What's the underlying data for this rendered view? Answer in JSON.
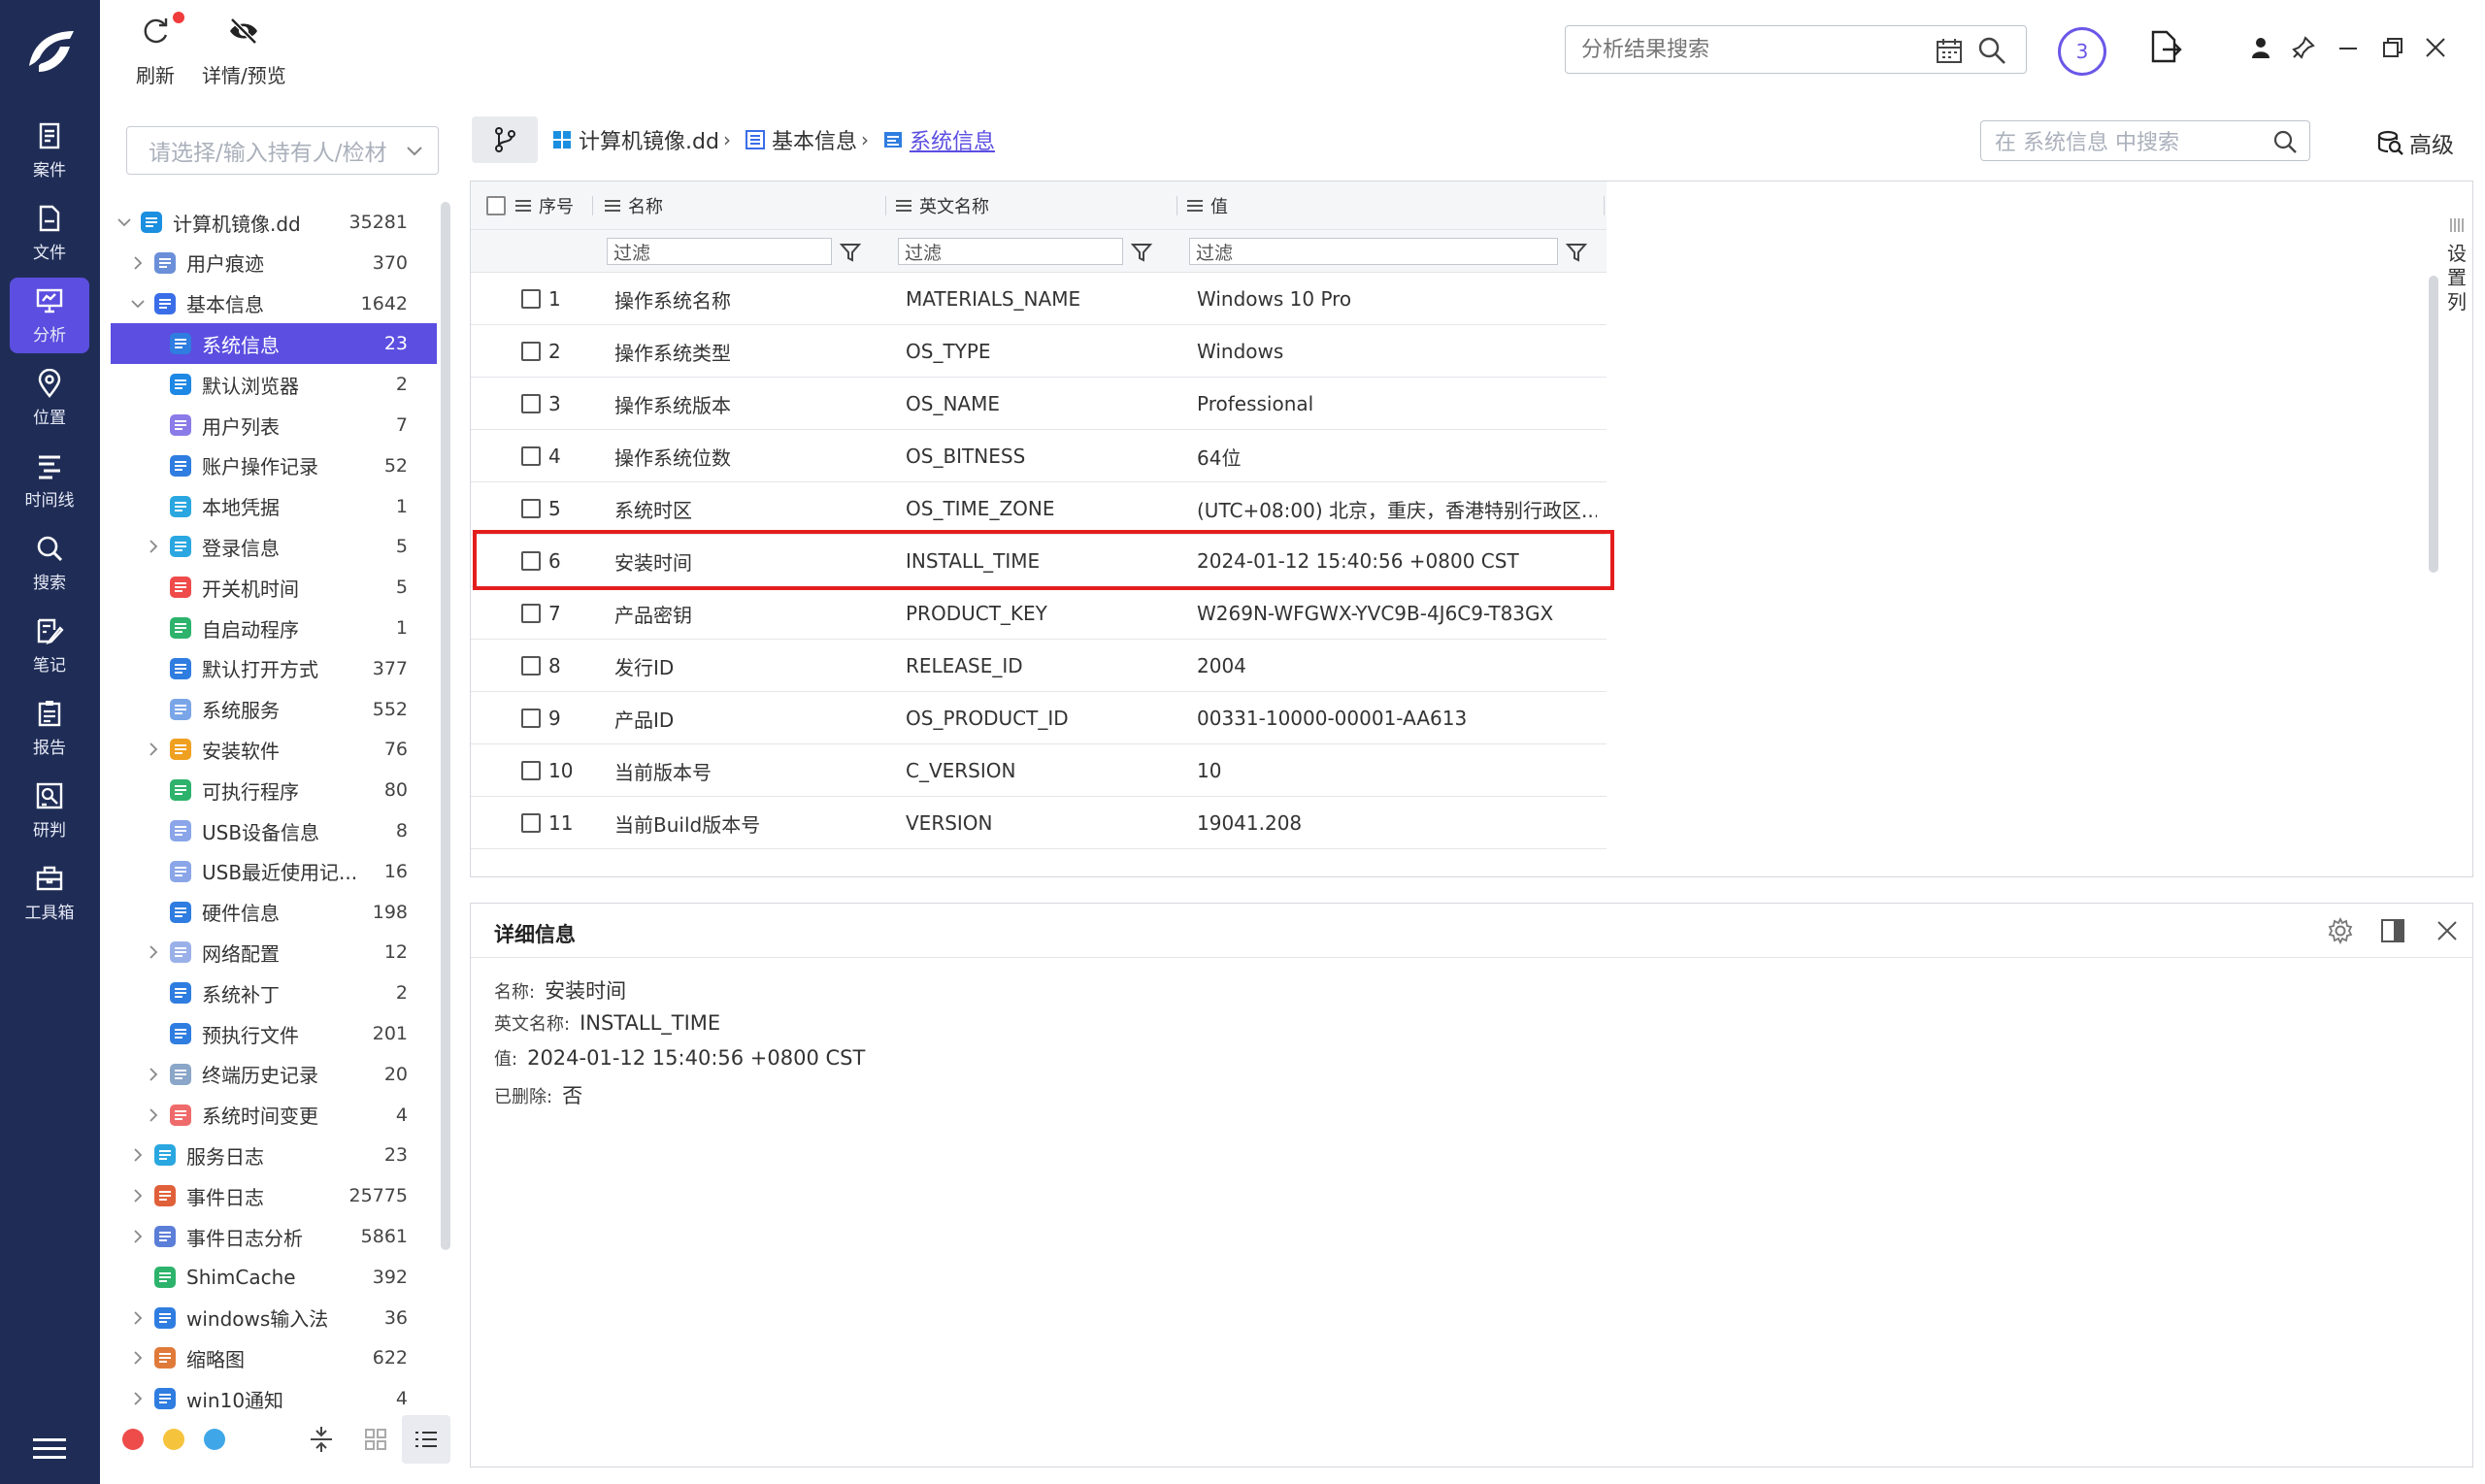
{
  "rail": {
    "items": [
      {
        "label": "案件",
        "icon": "case-icon"
      },
      {
        "label": "文件",
        "icon": "file-icon"
      },
      {
        "label": "分析",
        "icon": "analysis-icon"
      },
      {
        "label": "位置",
        "icon": "location-icon"
      },
      {
        "label": "时间线",
        "icon": "timeline-icon"
      },
      {
        "label": "搜索",
        "icon": "search-icon"
      },
      {
        "label": "笔记",
        "icon": "note-icon"
      },
      {
        "label": "报告",
        "icon": "report-icon"
      },
      {
        "label": "研判",
        "icon": "judge-icon"
      },
      {
        "label": "工具箱",
        "icon": "toolbox-icon"
      }
    ],
    "active": "分析"
  },
  "toolbar": {
    "refresh_label": "刷新",
    "detail_preview_label": "详情/预览",
    "result_search_placeholder": "分析结果搜索",
    "task_count": "3"
  },
  "tree": {
    "owner_placeholder": "请选择/输入持有人/检材",
    "items": [
      {
        "label": "计算机镜像.dd",
        "count": "35281",
        "level": 0,
        "expand": "open",
        "icon": "windows-icon"
      },
      {
        "label": "用户痕迹",
        "count": "370",
        "level": 1,
        "expand": "closed",
        "icon": "user-trace-icon"
      },
      {
        "label": "基本信息",
        "count": "1642",
        "level": 1,
        "expand": "open",
        "icon": "basic-info-icon"
      },
      {
        "label": "系统信息",
        "count": "23",
        "level": 2,
        "expand": "none",
        "icon": "system-info-icon",
        "selected": true
      },
      {
        "label": "默认浏览器",
        "count": "2",
        "level": 2,
        "expand": "none",
        "icon": "ie-browser-icon"
      },
      {
        "label": "用户列表",
        "count": "7",
        "level": 2,
        "expand": "none",
        "icon": "user-list-icon"
      },
      {
        "label": "账户操作记录",
        "count": "52",
        "level": 2,
        "expand": "none",
        "icon": "account-log-icon"
      },
      {
        "label": "本地凭据",
        "count": "1",
        "level": 2,
        "expand": "none",
        "icon": "credential-icon"
      },
      {
        "label": "登录信息",
        "count": "5",
        "level": 2,
        "expand": "closed",
        "icon": "login-icon"
      },
      {
        "label": "开关机时间",
        "count": "5",
        "level": 2,
        "expand": "none",
        "icon": "power-icon"
      },
      {
        "label": "自启动程序",
        "count": "1",
        "level": 2,
        "expand": "none",
        "icon": "autostart-icon"
      },
      {
        "label": "默认打开方式",
        "count": "377",
        "level": 2,
        "expand": "none",
        "icon": "default-open-icon"
      },
      {
        "label": "系统服务",
        "count": "552",
        "level": 2,
        "expand": "none",
        "icon": "service-icon"
      },
      {
        "label": "安装软件",
        "count": "76",
        "level": 2,
        "expand": "closed",
        "icon": "installed-software-icon"
      },
      {
        "label": "可执行程序",
        "count": "80",
        "level": 2,
        "expand": "none",
        "icon": "executable-icon"
      },
      {
        "label": "USB设备信息",
        "count": "8",
        "level": 2,
        "expand": "none",
        "icon": "usb-icon"
      },
      {
        "label": "USB最近使用记...",
        "count": "16",
        "level": 2,
        "expand": "none",
        "icon": "usb-recent-icon"
      },
      {
        "label": "硬件信息",
        "count": "198",
        "level": 2,
        "expand": "none",
        "icon": "hardware-icon"
      },
      {
        "label": "网络配置",
        "count": "12",
        "level": 2,
        "expand": "closed",
        "icon": "network-icon"
      },
      {
        "label": "系统补丁",
        "count": "2",
        "level": 2,
        "expand": "none",
        "icon": "patch-icon"
      },
      {
        "label": "预执行文件",
        "count": "201",
        "level": 2,
        "expand": "none",
        "icon": "prefetch-icon"
      },
      {
        "label": "终端历史记录",
        "count": "20",
        "level": 2,
        "expand": "closed",
        "icon": "terminal-icon"
      },
      {
        "label": "系统时间变更",
        "count": "4",
        "level": 2,
        "expand": "closed",
        "icon": "clock-icon"
      },
      {
        "label": "服务日志",
        "count": "23",
        "level": 1,
        "expand": "closed",
        "icon": "service-log-icon"
      },
      {
        "label": "事件日志",
        "count": "25775",
        "level": 1,
        "expand": "closed",
        "icon": "event-log-icon"
      },
      {
        "label": "事件日志分析",
        "count": "5861",
        "level": 1,
        "expand": "closed",
        "icon": "event-analysis-icon"
      },
      {
        "label": "ShimCache",
        "count": "392",
        "level": 1,
        "expand": "none",
        "icon": "shimcache-icon"
      },
      {
        "label": "windows输入法",
        "count": "36",
        "level": 1,
        "expand": "closed",
        "icon": "keyboard-icon"
      },
      {
        "label": "缩略图",
        "count": "622",
        "level": 1,
        "expand": "closed",
        "icon": "thumbnail-icon"
      },
      {
        "label": "win10通知",
        "count": "4",
        "level": 1,
        "expand": "closed",
        "icon": "bell-icon"
      }
    ],
    "footer_dots": [
      "#ee4b4b",
      "#f6c33d",
      "#3fa7e8"
    ]
  },
  "breadcrumb": {
    "items": [
      "计算机镜像.dd",
      "基本信息",
      "系统信息"
    ],
    "inner_search_placeholder": "在 系统信息 中搜索",
    "advanced_label": "高级"
  },
  "grid": {
    "columns": [
      "序号",
      "名称",
      "英文名称",
      "值"
    ],
    "filter_placeholder": "过滤",
    "rows": [
      {
        "no": "1",
        "name": "操作系统名称",
        "en": "MATERIALS_NAME",
        "value": "Windows 10 Pro"
      },
      {
        "no": "2",
        "name": "操作系统类型",
        "en": "OS_TYPE",
        "value": "Windows"
      },
      {
        "no": "3",
        "name": "操作系统版本",
        "en": "OS_NAME",
        "value": "Professional"
      },
      {
        "no": "4",
        "name": "操作系统位数",
        "en": "OS_BITNESS",
        "value": "64位"
      },
      {
        "no": "5",
        "name": "系统时区",
        "en": "OS_TIME_ZONE",
        "value": "(UTC+08:00) 北京，重庆，香港特别行政区..."
      },
      {
        "no": "6",
        "name": "安装时间",
        "en": "INSTALL_TIME",
        "value": "2024-01-12 15:40:56 +0800 CST",
        "highlighted": true
      },
      {
        "no": "7",
        "name": "产品密钥",
        "en": "PRODUCT_KEY",
        "value": "W269N-WFGWX-YVC9B-4J6C9-T83GX"
      },
      {
        "no": "8",
        "name": "发行ID",
        "en": "RELEASE_ID",
        "value": "2004"
      },
      {
        "no": "9",
        "name": "产品ID",
        "en": "OS_PRODUCT_ID",
        "value": "00331-10000-00001-AA613"
      },
      {
        "no": "10",
        "name": "当前版本号",
        "en": "C_VERSION",
        "value": "10"
      },
      {
        "no": "11",
        "name": "当前Build版本号",
        "en": "VERSION",
        "value": "19041.208"
      }
    ],
    "set_columns_label": "设置列",
    "highlight_color": "#e41d1d"
  },
  "detail": {
    "title": "详细信息",
    "fields": [
      {
        "k": "名称:",
        "v": "安装时间"
      },
      {
        "k": "英文名称:",
        "v": "INSTALL_TIME"
      },
      {
        "k": "值:",
        "v": "2024-01-12 15:40:56 +0800 CST"
      },
      {
        "k": "已删除:",
        "v": "否"
      }
    ]
  },
  "colors": {
    "rail_bg": "#1f2d56",
    "accent": "#5b4ee0"
  }
}
